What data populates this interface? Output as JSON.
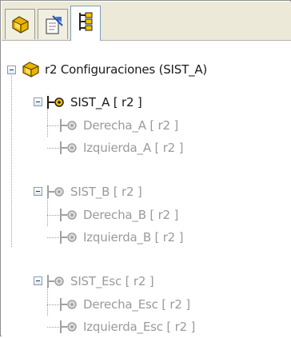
{
  "tabs": [
    {
      "icon": "feature-manager-icon",
      "active": false
    },
    {
      "icon": "property-manager-icon",
      "active": false
    },
    {
      "icon": "configuration-manager-icon",
      "active": true
    }
  ],
  "tree": {
    "root": {
      "label": "r2 Configuraciones  (SIST_A)",
      "icon": "assembly-config-icon"
    },
    "groups": [
      {
        "label": "SIST_A [ r2 ]",
        "active": true,
        "children": [
          {
            "label": "Derecha_A [ r2 ]"
          },
          {
            "label": "Izquierda_A [ r2 ]"
          }
        ]
      },
      {
        "label": "SIST_B [ r2 ]",
        "active": false,
        "children": [
          {
            "label": "Derecha_B [ r2 ]"
          },
          {
            "label": "Izquierda_B [ r2 ]"
          }
        ]
      },
      {
        "label": "SIST_Esc [ r2 ]",
        "active": false,
        "children": [
          {
            "label": "Derecha_Esc [ r2 ]"
          },
          {
            "label": "Izquierda_Esc [ r2 ]"
          }
        ]
      }
    ]
  },
  "colors": {
    "active_text": "#1a1a1a",
    "inactive_text": "#9a9a9a",
    "config_icon_active": "#1e1e1e",
    "config_icon_inactive": "#a0a0a0",
    "accent": "#f2c300"
  }
}
